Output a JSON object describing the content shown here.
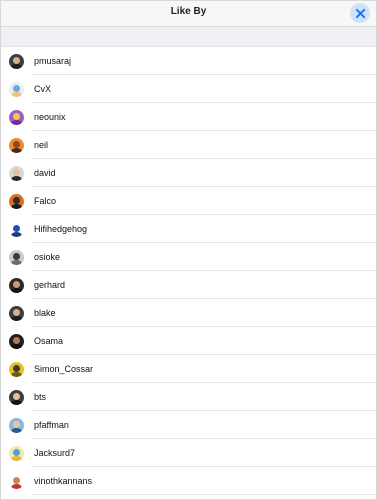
{
  "header": {
    "title": "Like By",
    "close_icon": "close-icon"
  },
  "users": [
    {
      "name": "pmusaraj",
      "bg": "#3a3f46",
      "head": "#d7b08a",
      "body": "#1e2226"
    },
    {
      "name": "CvX",
      "bg": "#e9eef2",
      "head": "#6aa9e0",
      "body": "#f1c27d"
    },
    {
      "name": "neounix",
      "bg": "#9b5fc9",
      "head": "#f2c94c",
      "body": "#6b2f9a"
    },
    {
      "name": "neil",
      "bg": "#f08a2f",
      "head": "#8a4a1f",
      "body": "#4a2a14"
    },
    {
      "name": "david",
      "bg": "#d9d9d9",
      "head": "#e3c2a0",
      "body": "#2a2a2a"
    },
    {
      "name": "Falco",
      "bg": "#e06a1e",
      "head": "#2b2b2b",
      "body": "#1a1a1a"
    },
    {
      "name": "Hifihedgehog",
      "bg": "#ffffff",
      "head": "#1f4fb8",
      "body": "#233a7a"
    },
    {
      "name": "osioke",
      "bg": "#c9c9c9",
      "head": "#3a3a3a",
      "body": "#6a6a6a"
    },
    {
      "name": "gerhard",
      "bg": "#2b2b2b",
      "head": "#c99a78",
      "body": "#141414"
    },
    {
      "name": "blake",
      "bg": "#3c3c3c",
      "head": "#d4b090",
      "body": "#1c1c1c"
    },
    {
      "name": "Osama",
      "bg": "#1f1f1f",
      "head": "#b07a56",
      "body": "#0f0f0f"
    },
    {
      "name": "Simon_Cossar",
      "bg": "#e7c21a",
      "head": "#3a3a3a",
      "body": "#6d5a10"
    },
    {
      "name": "bts",
      "bg": "#3d3d3d",
      "head": "#e0c0a0",
      "body": "#151515"
    },
    {
      "name": "pfaffman",
      "bg": "#8ab6e0",
      "head": "#e5c5a8",
      "body": "#2a5d8f"
    },
    {
      "name": "Jacksurd7",
      "bg": "#f4e7a8",
      "head": "#4aa3e0",
      "body": "#e0b840"
    },
    {
      "name": "vinothkannans",
      "bg": "#ffffff",
      "head": "#c8855a",
      "body": "#c0392b"
    }
  ]
}
